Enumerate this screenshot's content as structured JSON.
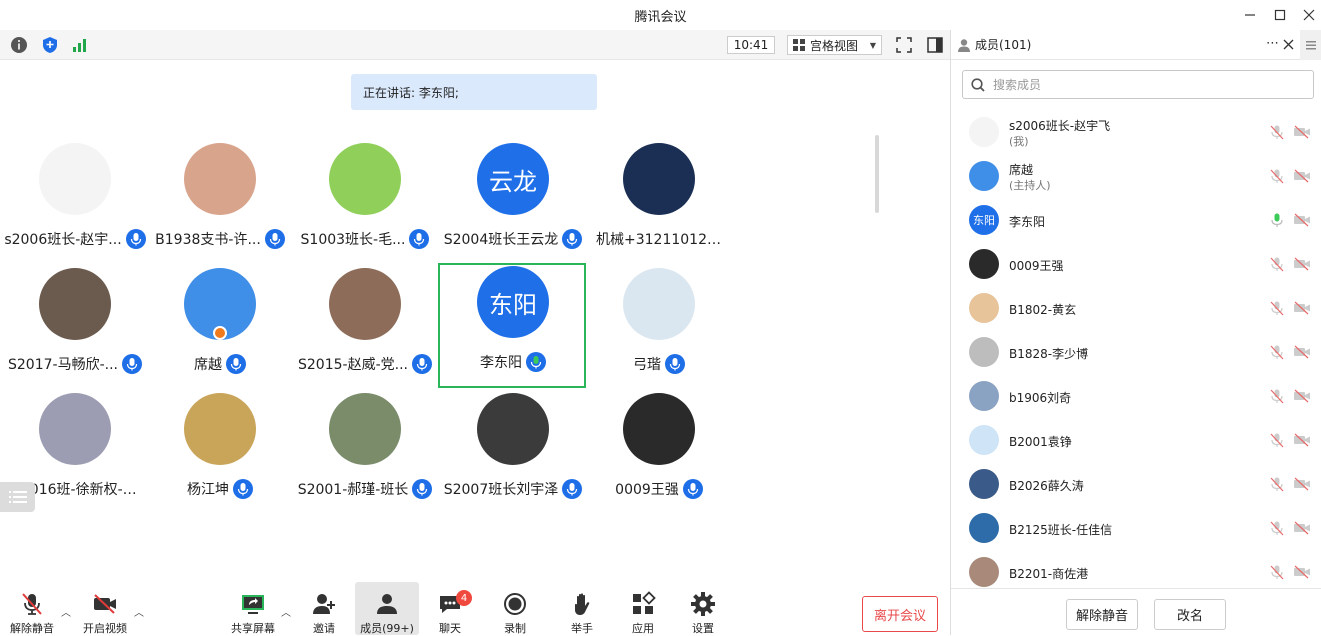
{
  "window": {
    "title": "腾讯会议"
  },
  "topbar": {
    "time": "10:41",
    "view_label": "宫格视图"
  },
  "speaking": {
    "text": "正在讲话: 李东阳;"
  },
  "tiles": [
    {
      "name": "s2006班长-赵宇...",
      "avatar_color": "#f4f4f4",
      "initials": "",
      "mic": "blue"
    },
    {
      "name": "B1938支书-许...",
      "avatar_color": "#d9a48c",
      "initials": "",
      "mic": "blue"
    },
    {
      "name": "S1003班长-毛...",
      "avatar_color": "#8fcf5a",
      "initials": "",
      "mic": "blue"
    },
    {
      "name": "S2004班长王云龙",
      "avatar_color": "#1f6fe8",
      "initials": "云龙",
      "mic": "blue"
    },
    {
      "name": "机械+3121101228...",
      "avatar_color": "#1b2f55",
      "initials": "",
      "mic": "none"
    },
    {
      "name": "S2017-马畅欣-...",
      "avatar_color": "#6b5a4e",
      "initials": "",
      "mic": "blue"
    },
    {
      "name": "席越",
      "avatar_color": "#3f8ee8",
      "initials": "",
      "mic": "blue",
      "host": true
    },
    {
      "name": "S2015-赵威-党...",
      "avatar_color": "#8d6d5a",
      "initials": "",
      "mic": "blue"
    },
    {
      "name": "李东阳",
      "avatar_color": "#1f6fe8",
      "initials": "东阳",
      "mic": "green",
      "active": true
    },
    {
      "name": "弓瑎",
      "avatar_color": "#dbe7f0",
      "initials": "",
      "mic": "blue"
    },
    {
      "name": "S2016班-徐新权-班...",
      "avatar_color": "#9c9cb3",
      "initials": "",
      "mic": "none"
    },
    {
      "name": "杨江坤",
      "avatar_color": "#c9a55a",
      "initials": "",
      "mic": "blue"
    },
    {
      "name": "S2001-郝瑾-班长",
      "avatar_color": "#7a8c6a",
      "initials": "",
      "mic": "blue"
    },
    {
      "name": "S2007班长刘宇泽",
      "avatar_color": "#3b3b3b",
      "initials": "",
      "mic": "blue"
    },
    {
      "name": "0009王强",
      "avatar_color": "#2a2a2a",
      "initials": "",
      "mic": "blue"
    }
  ],
  "toolbar": {
    "unmute": "解除静音",
    "start_video": "开启视频",
    "share_screen": "共享屏幕",
    "invite": "邀请",
    "members": "成员(99+)",
    "chat": "聊天",
    "chat_badge": "4",
    "record": "录制",
    "raise_hand": "举手",
    "apps": "应用",
    "settings": "设置",
    "leave": "离开会议"
  },
  "panel": {
    "title": "成员(101)",
    "search_placeholder": "搜索成员",
    "members": [
      {
        "name": "s2006班长-赵宇飞",
        "sub": "(我)",
        "avatar_color": "#f4f4f4",
        "initials": "",
        "mic_on": false
      },
      {
        "name": "席越",
        "sub": "(主持人)",
        "avatar_color": "#3f8ee8",
        "initials": "",
        "mic_on": false
      },
      {
        "name": "李东阳",
        "sub": "",
        "avatar_color": "#1f6fe8",
        "initials": "东阳",
        "mic_on": true
      },
      {
        "name": "0009王强",
        "sub": "",
        "avatar_color": "#2a2a2a",
        "initials": "",
        "mic_on": false
      },
      {
        "name": "B1802-黄玄",
        "sub": "",
        "avatar_color": "#e8c49a",
        "initials": "",
        "mic_on": false
      },
      {
        "name": "B1828-李少博",
        "sub": "",
        "avatar_color": "#bdbdbd",
        "initials": "",
        "mic_on": false
      },
      {
        "name": "b1906刘奇",
        "sub": "",
        "avatar_color": "#8aa3c2",
        "initials": "",
        "mic_on": false
      },
      {
        "name": "B2001袁铮",
        "sub": "",
        "avatar_color": "#cfe4f7",
        "initials": "",
        "mic_on": false
      },
      {
        "name": "B2026薛久涛",
        "sub": "",
        "avatar_color": "#3a5a8a",
        "initials": "",
        "mic_on": false
      },
      {
        "name": "B2125班长-任佳信",
        "sub": "",
        "avatar_color": "#2d6ca8",
        "initials": "",
        "mic_on": false
      },
      {
        "name": "B2201-商佐港",
        "sub": "",
        "avatar_color": "#a98a7a",
        "initials": "",
        "mic_on": false
      }
    ],
    "unmute_button": "解除静音",
    "rename_button": "改名"
  }
}
